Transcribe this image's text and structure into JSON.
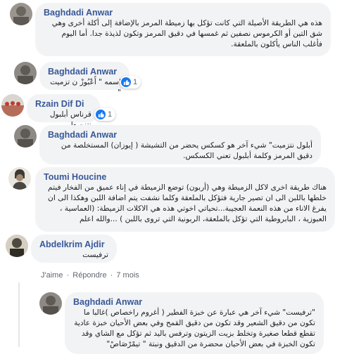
{
  "comments": [
    {
      "author": "Baghdadi Anwar",
      "text": "هذه هي الطريقة الأصيلة التي كانت تؤكل بها زميطة المرمز بالإضافة إلى أكلة أخرى وهي شق التين أو الكرموس نصفين ثم غمسها في دقيق المرمز وتكون لذيذة جدا. أما اليوم فأغلب الناس يأكلون بالملعقة."
    },
    {
      "author": "Baghdadi Anwar",
      "text": "اسمه \" أَعْبُوزْ ن تزميت \"",
      "reaction_count": "1"
    },
    {
      "author": "Rzain Dif Di",
      "text": "قرناس أبلبول نتزميط",
      "reaction_count": "1"
    },
    {
      "author": "Baghdadi Anwar",
      "text": "أبلول نتزميت\" شيء آخر هو كسكس يحضر من التشيشة ( إيوزان) المستخلصة من دقيق المرمز وكلمة أبلبول تعني الكسكس."
    },
    {
      "author": "Toumi Houcine",
      "text": "هناك طريقة اخرى لاكل الزميطة وهي (أربون) توضع الزميطة في إناء عميق من الفخار فيتم خلطها باللبن الى ان تصير جارية فتؤكل بالملعقة وكلما نشفت يتم اضافة اللبن وهكذا الى ان يفرغ الاناء من هذه النعمة العجيبة...تحياتي اخوتي هذه هي الاكلات الزميطة: (العماسية ، العبوزية ، البابروطية التي تؤكل بالملعقة، الربونية التي تروى باللبن ) ...والله اعلم"
    },
    {
      "author": "Abdelkrim Ajdir",
      "text": "ترفيست"
    },
    {
      "author": "Baghdadi Anwar",
      "text": "\"ترفيست\" شيء آخر هي عبارة عن خبزة الفطير ( أغروم راخصاص )غالبا ما تكون من دقيق الشعير وقد تكون من دقيق القمح وفي بعض الأحيان خبزة عادية تقطع قطعا صغيرة وتخلط بزيت الزيتون وترفس باليد ثم تؤكل مع الشاي وقد تكون الخبزة في بعض الأحيان محضرة من الدقيق ونبتة \" تيمْرْصَاصْ\""
    }
  ],
  "actions": {
    "like": "J'aime",
    "reply": "Répondre",
    "time": "7 mois",
    "separator": "·"
  },
  "colors": {
    "author": "#385898",
    "bubble": "#f2f3f5",
    "like_blue": "#1877f2"
  },
  "icons": {
    "reaction": "like-thumb-icon"
  }
}
